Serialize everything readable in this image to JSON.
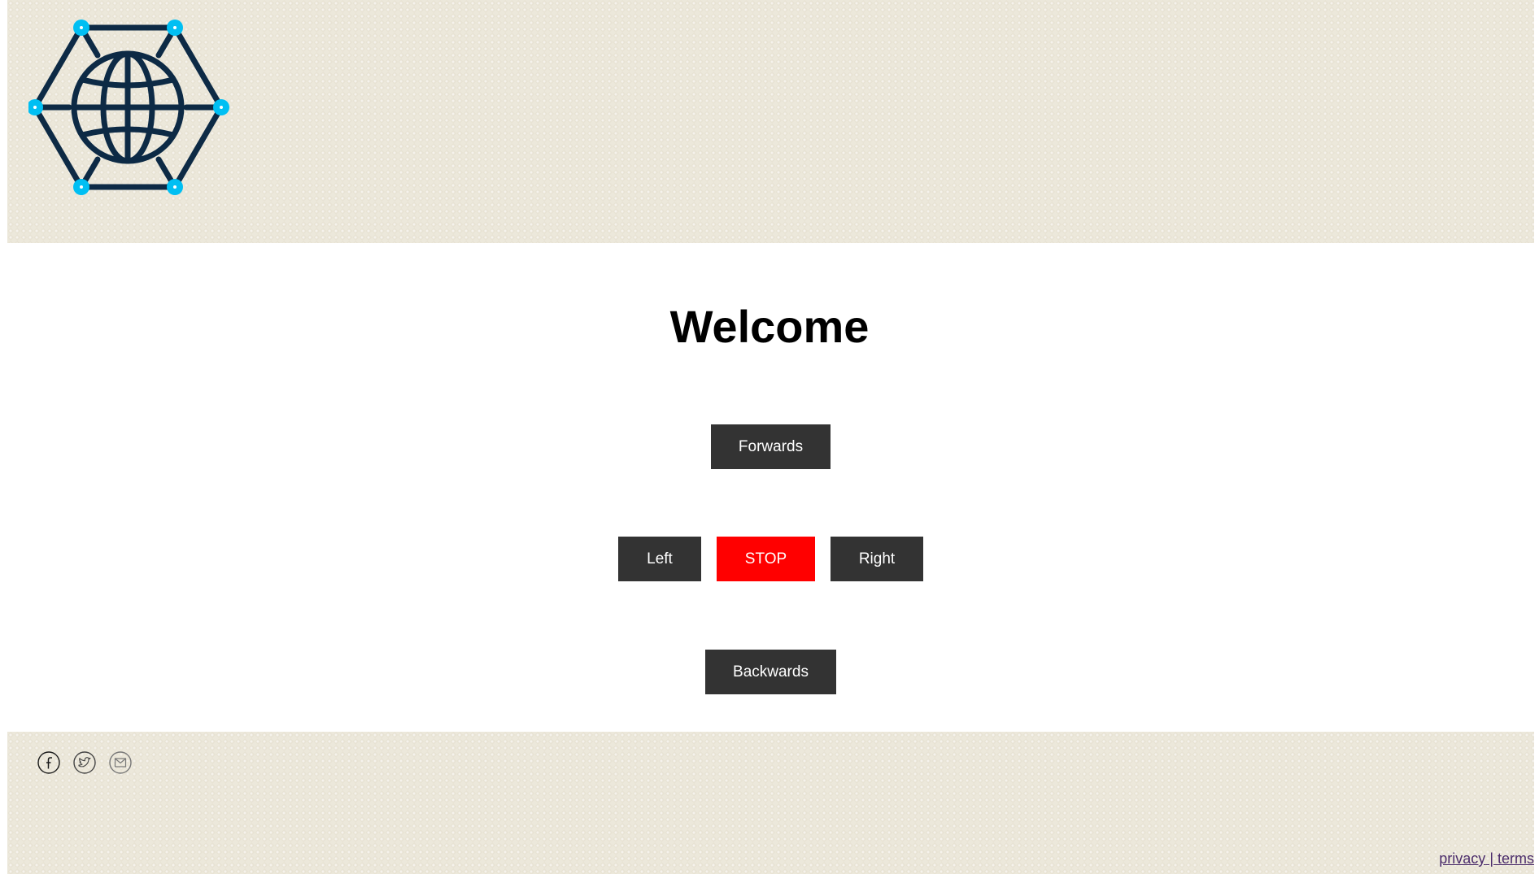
{
  "header": {
    "logo_icon": "globe-network-hexagon-icon"
  },
  "main": {
    "title": "Welcome",
    "controls": {
      "forwards": "Forwards",
      "left": "Left",
      "stop": "STOP",
      "right": "Right",
      "backwards": "Backwards"
    }
  },
  "footer": {
    "social": [
      "facebook-icon",
      "twitter-icon",
      "email-icon"
    ],
    "privacy": "privacy",
    "separator": " | ",
    "terms": "terms"
  },
  "colors": {
    "texture_bg": "#e8e3d4",
    "button": "#333333",
    "stop_button": "#ff0000",
    "logo_dark": "#0d2a45",
    "logo_node": "#00bff3",
    "link": "#4b2c6b"
  }
}
